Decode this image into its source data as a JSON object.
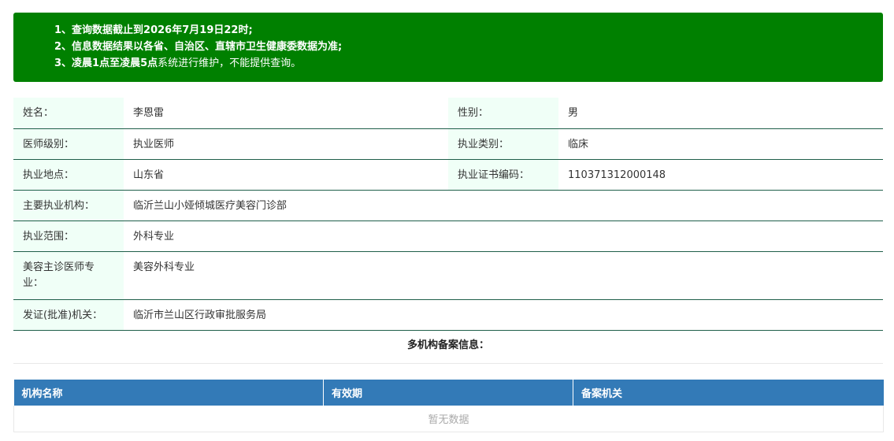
{
  "notice": {
    "line1": "1、查询数据截止到2026年7月19日22时;",
    "line2": "2、信息数据结果以各省、自治区、直辖市卫生健康委数据为准;",
    "line3_bold": "3、凌晨1点至凌晨5点",
    "line3_rest": "系统进行维护，不能提供查询。"
  },
  "info": {
    "name_label": "姓名：",
    "name_value": "李恩雷",
    "gender_label": "性别：",
    "gender_value": "男",
    "level_label": "医师级别：",
    "level_value": "执业医师",
    "category_label": "执业类别：",
    "category_value": "临床",
    "location_label": "执业地点：",
    "location_value": "山东省",
    "cert_label": "执业证书编码：",
    "cert_value": "110371312000148",
    "org_label": "主要执业机构：",
    "org_value": "临沂兰山小娅倾城医疗美容门诊部",
    "scope_label": "执业范围：",
    "scope_value": "外科专业",
    "cosmetic_label": "美容主诊医师专业：",
    "cosmetic_value": "美容外科专业",
    "issuer_label": "发证(批准)机关：",
    "issuer_value": "临沂市兰山区行政审批服务局"
  },
  "multi": {
    "title": "多机构备案信息：",
    "columns": [
      "机构名称",
      "有效期",
      "备案机关"
    ],
    "empty_text": "暂无数据"
  }
}
